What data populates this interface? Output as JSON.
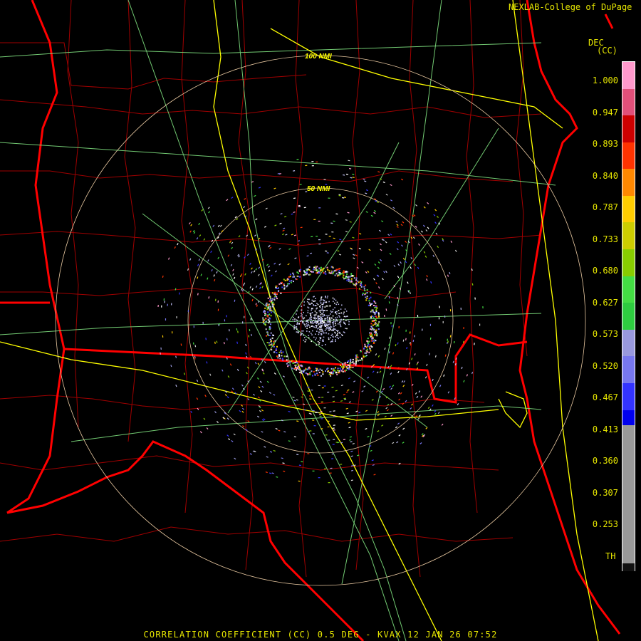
{
  "credit": "NEXLAB-College of DuPage",
  "product_code": "DEC",
  "units": "(CC)",
  "footer": "CORRELATION COEFFICIENT (CC) 0.5 DEG - KVAX 12 JAN 26 07:52",
  "range_rings": [
    {
      "label": "50 NMI"
    },
    {
      "label": "100 NMI"
    }
  ],
  "legend": {
    "ticks": [
      "1.000",
      "0.947",
      "0.893",
      "0.840",
      "0.787",
      "0.733",
      "0.680",
      "0.627",
      "0.573",
      "0.520",
      "0.467",
      "0.413",
      "0.360",
      "0.307",
      "0.253",
      "TH"
    ],
    "colors": [
      "#ff99cc",
      "#e0507a",
      "#cc0000",
      "#ff3300",
      "#ff8800",
      "#ffcc00",
      "#cccc00",
      "#88cc00",
      "#44dd44",
      "#2ecc40",
      "#9999dd",
      "#7777ee",
      "#3333ff",
      "#0000ee",
      "#0000cc",
      "#000099",
      "#7777aa",
      "#999999",
      "#111111"
    ]
  },
  "colors": {
    "state_border": "#ff0000",
    "county_border": "#b00000",
    "highway": "#ffff00",
    "road": "#88ff88",
    "range_ring": "#e8c8a0"
  },
  "radar_site": "KVAX"
}
